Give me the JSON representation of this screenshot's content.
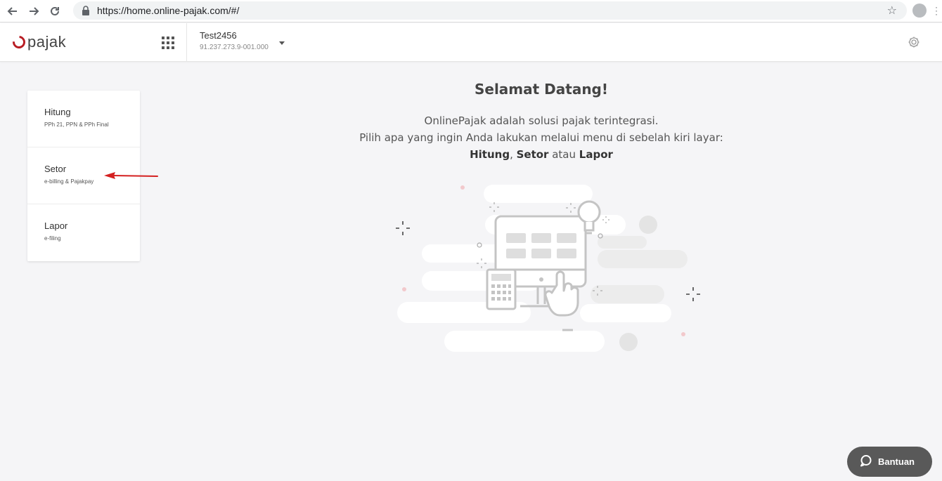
{
  "browser": {
    "url": "https://home.online-pajak.com/#/"
  },
  "header": {
    "logo_text": "pajak",
    "company_name": "Test2456",
    "company_npwp": "91.237.273.9-001.000"
  },
  "menu": {
    "items": [
      {
        "title": "Hitung",
        "subtitle": "PPh 21, PPN & PPh Final"
      },
      {
        "title": "Setor",
        "subtitle": "e-billing & Pajakpay"
      },
      {
        "title": "Lapor",
        "subtitle": "e-filing"
      }
    ]
  },
  "welcome": {
    "title": "Selamat Datang!",
    "line1": "OnlinePajak adalah solusi pajak terintegrasi.",
    "line2": "Pilih apa yang ingin Anda lakukan melalui menu di sebelah kiri layar:",
    "opt1": "Hitung",
    "sep1": ", ",
    "opt2": "Setor",
    "sep2": " atau ",
    "opt3": "Lapor"
  },
  "help": {
    "label": "Bantuan"
  },
  "colors": {
    "brand": "#b81d24",
    "arrow": "#d42020",
    "help_button": "#595959"
  }
}
